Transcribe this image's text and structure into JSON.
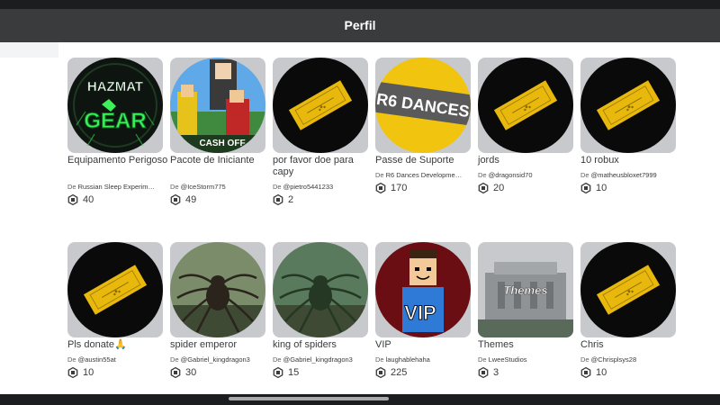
{
  "header": {
    "title": "Perfil"
  },
  "creator_prefix": "De",
  "items": [
    {
      "name": "Equipamento Perigoso",
      "creator": "Russian Sleep Experim…",
      "price": "40",
      "thumb": "hazmat",
      "thumb_text": [
        "HAZMAT",
        "GEAR"
      ]
    },
    {
      "name": "Pacote de Iniciante",
      "creator": "@IceStorm775",
      "price": "49",
      "thumb": "starter",
      "thumb_text": [
        "CASH OFF"
      ]
    },
    {
      "name": "por favor doe para capy",
      "creator": "@pietro5441233",
      "price": "2",
      "thumb": "pass"
    },
    {
      "name": "Passe de Suporte",
      "creator": "R6 Dances Developme…",
      "price": "170",
      "thumb": "r6",
      "thumb_text": [
        "R6 DANCES"
      ]
    },
    {
      "name": "jords",
      "creator": "@dragonsid70",
      "price": "20",
      "thumb": "pass"
    },
    {
      "name": "10 robux",
      "creator": "@matheusbloxet7999",
      "price": "10",
      "thumb": "pass"
    },
    {
      "name": "Pls donate🙏",
      "creator": "@austin55at",
      "price": "10",
      "thumb": "pass"
    },
    {
      "name": "spider emperor",
      "creator": "@Gabriel_kingdragon3",
      "price": "30",
      "thumb": "spider1"
    },
    {
      "name": "king of spiders",
      "creator": "@Gabriel_kingdragon3",
      "price": "15",
      "thumb": "spider2"
    },
    {
      "name": "VIP",
      "creator": "laughablehaha",
      "price": "225",
      "thumb": "vip",
      "thumb_text": [
        "VIP"
      ]
    },
    {
      "name": "Themes",
      "creator": "LweeStudios",
      "price": "3",
      "thumb": "themes",
      "thumb_text": [
        "Themes"
      ]
    },
    {
      "name": "Chris",
      "creator": "@Chrisplsys28",
      "price": "10",
      "thumb": "pass"
    }
  ],
  "colors": {
    "header_bg": "#393b3d",
    "pass_gold": "#e8b80c",
    "card_bg": "#c8c9cc"
  }
}
